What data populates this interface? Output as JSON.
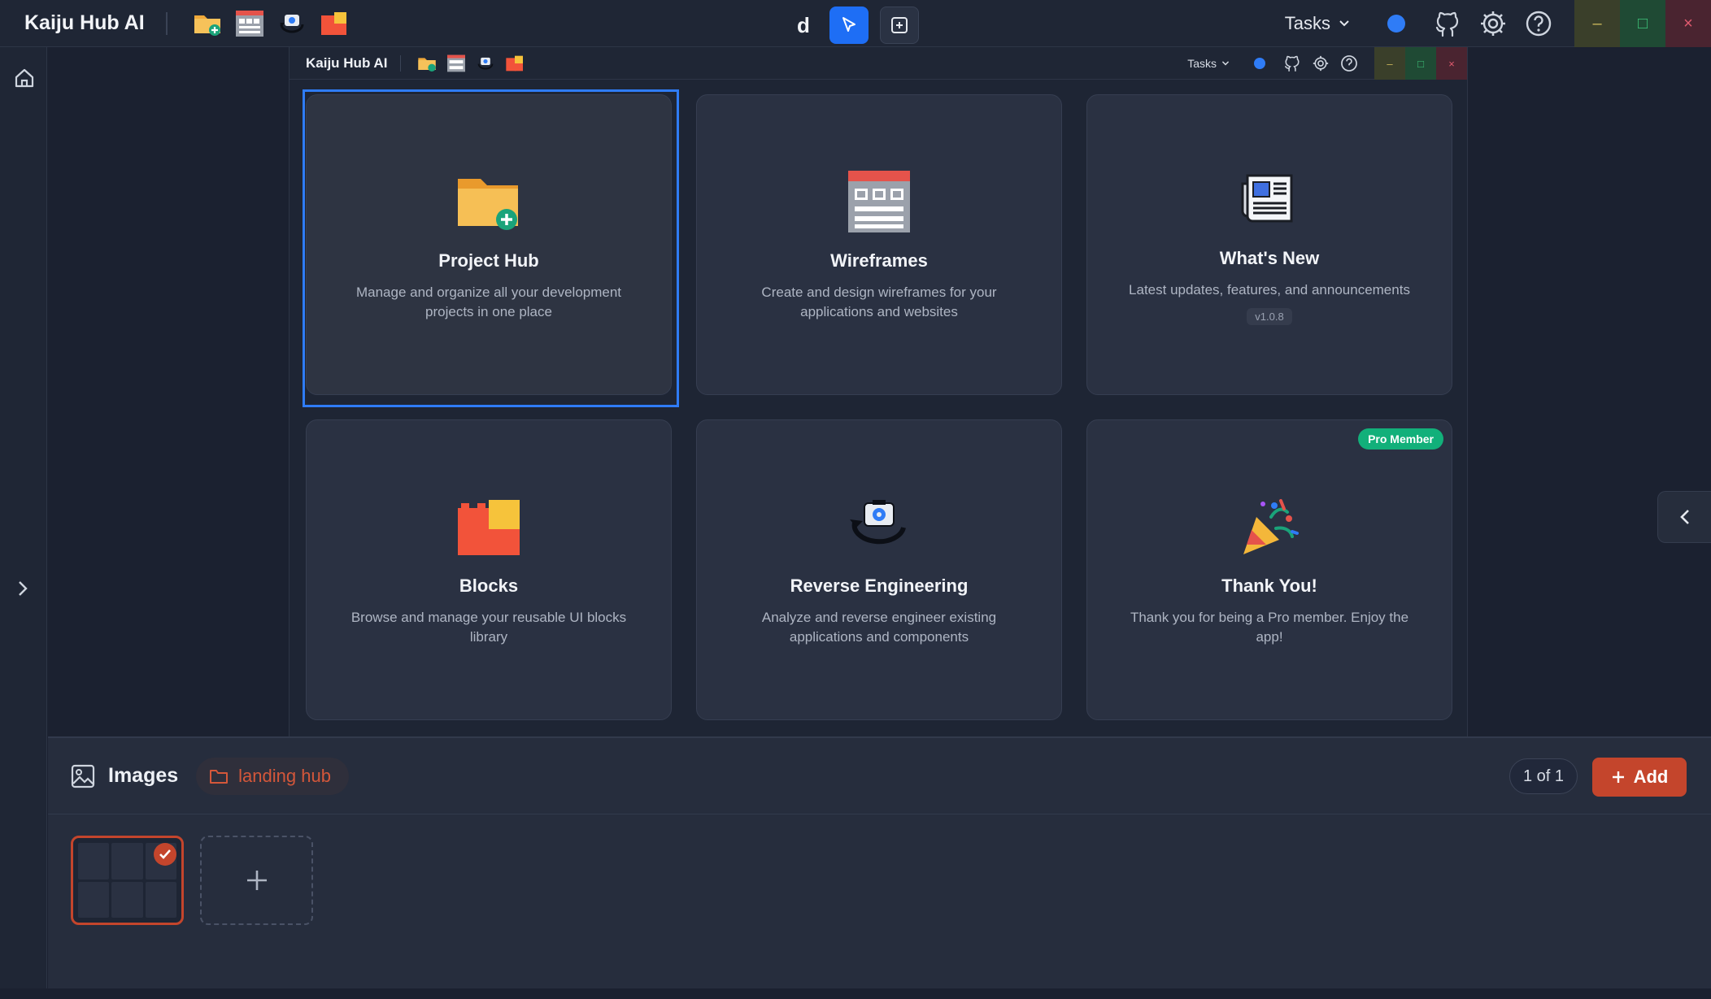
{
  "app": {
    "title": "Kaiju Hub AI"
  },
  "toolbar": {
    "tool_letter": "d",
    "tasks_label": "Tasks"
  },
  "inner_window": {
    "title": "Kaiju Hub AI",
    "tasks_label": "Tasks"
  },
  "cards": [
    {
      "title": "Project Hub",
      "description": "Manage and organize all your development projects in one place",
      "icon": "folder-plus-icon"
    },
    {
      "title": "Wireframes",
      "description": "Create and design wireframes for your applications and websites",
      "icon": "wireframe-icon"
    },
    {
      "title": "What's New",
      "description": "Latest updates, features, and announcements",
      "version": "v1.0.8",
      "icon": "newspaper-icon"
    },
    {
      "title": "Blocks",
      "description": "Browse and manage your reusable UI blocks library",
      "icon": "blocks-icon"
    },
    {
      "title": "Reverse Engineering",
      "description": "Analyze and reverse engineer existing applications and components",
      "icon": "camera-rotate-icon"
    },
    {
      "title": "Thank You!",
      "description": "Thank you for being a Pro member. Enjoy the app!",
      "badge": "Pro Member",
      "icon": "party-popper-icon"
    }
  ],
  "images_panel": {
    "title": "Images",
    "folder": "landing hub",
    "page_count": "1 of 1",
    "add_label": "Add"
  },
  "colors": {
    "accent_blue": "#2f7cf6",
    "accent_orange": "#c4452c",
    "pro_green": "#12b07a"
  }
}
